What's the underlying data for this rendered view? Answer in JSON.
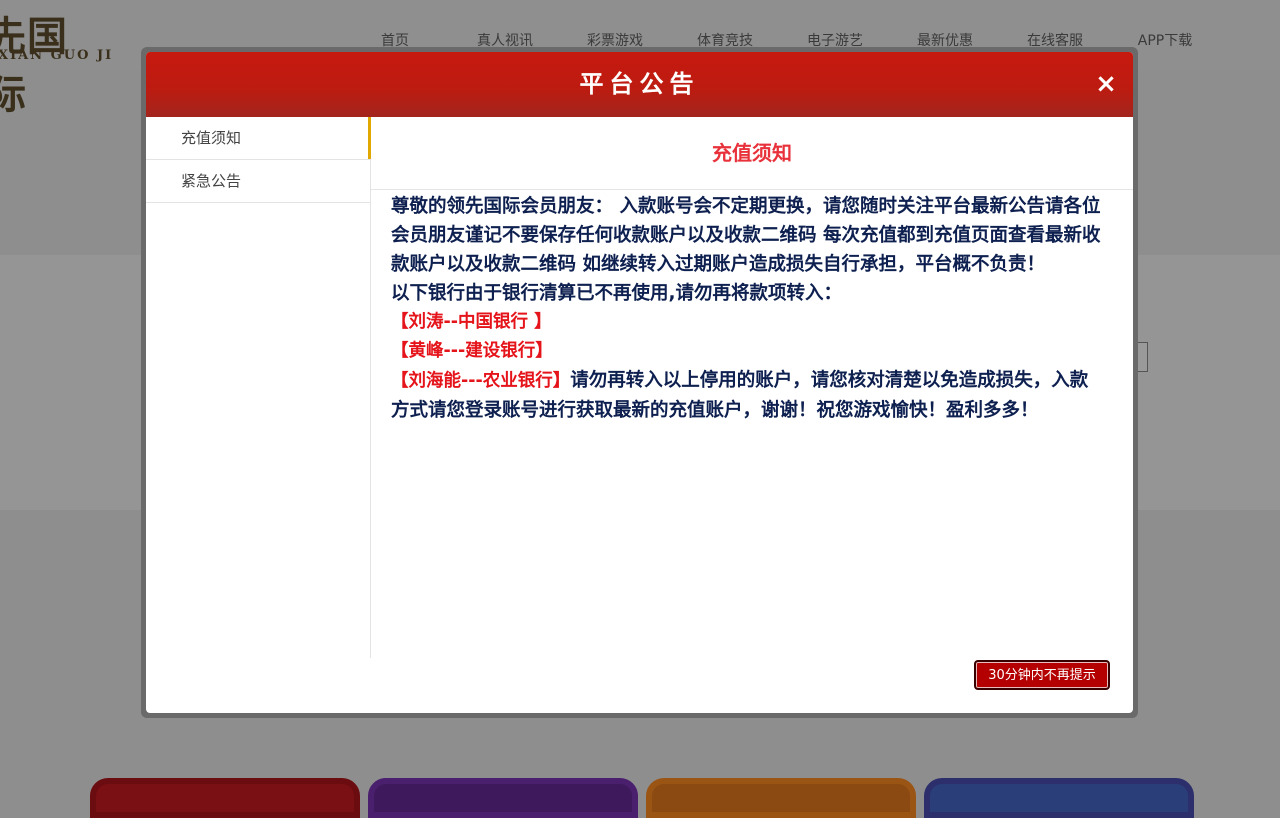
{
  "background": {
    "logo": {
      "cn": "先国际",
      "en": "XIAN GUO JI"
    },
    "nav": [
      "首页",
      "真人视讯",
      "彩票游戏",
      "体育竞技",
      "电子游艺",
      "最新优惠",
      "在线客服",
      "APP下载"
    ]
  },
  "modal": {
    "title": "平台公告",
    "close_icon": "×",
    "tabs": [
      {
        "label": "充值须知",
        "active": true
      },
      {
        "label": "紧急公告",
        "active": false
      }
    ],
    "content_title": "充值须知",
    "body": {
      "para1": "尊敬的领先国际会员朋友： 入款账号会不定期更换，请您随时关注平台最新公告请各位会员朋友谨记不要保存任何收款账户以及收款二维码 每次充值都到充值页面查看最新收款账户以及收款二维码 如继续转入过期账户造成损失自行承担，平台概不负责！",
      "para2": "以下银行由于银行清算已不再使用,请勿再将款项转入：",
      "bank1": "【刘涛--中国银行 】",
      "bank2": "【黄峰---建设银行】",
      "bank3": "【刘海能---农业银行】",
      "para3": "请勿再转入以上停用的账户，请您核对清楚以免造成损失，入款方式请您登录账号进行获取最新的充值账户，谢谢！祝您游戏愉快！盈利多多！"
    },
    "dismiss_button": "30分钟内不再提示"
  },
  "colors": {
    "header_red": "#c61a0f",
    "content_title": "#e8313a",
    "body_text": "#0e2050",
    "bank_red": "#e5141b",
    "active_tab_marker": "#e0a800",
    "button_bg": "#b40000"
  }
}
